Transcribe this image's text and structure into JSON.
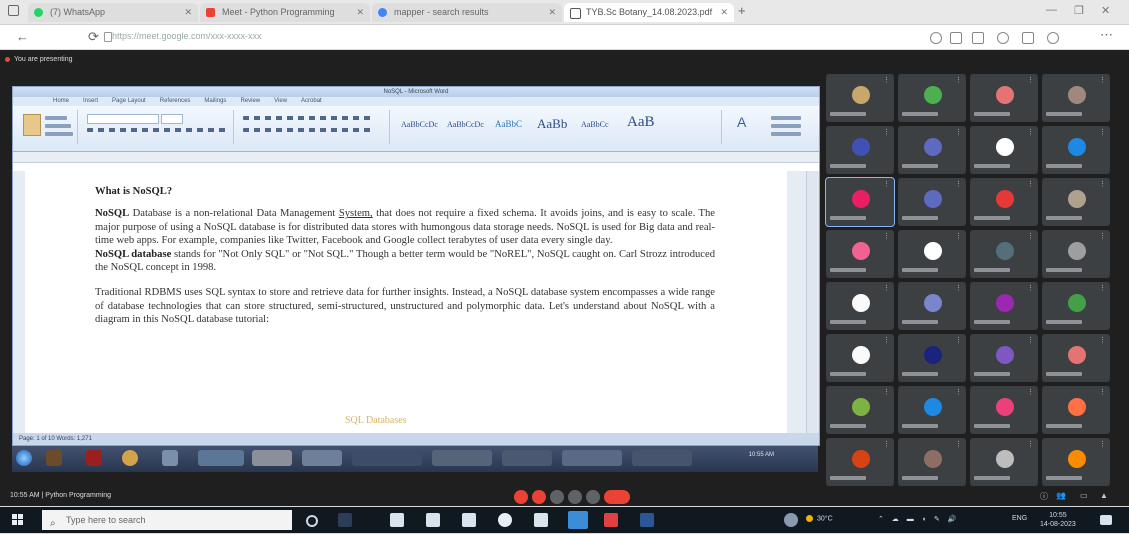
{
  "browser": {
    "tabs": [
      {
        "label": "(7) WhatsApp",
        "active": false,
        "icon_color": "#25d366"
      },
      {
        "label": "Meet - Python Programming",
        "active": false,
        "icon_color": "#ea4335"
      },
      {
        "label": "mapper - search results",
        "active": false,
        "icon_color": "#4285f4"
      },
      {
        "label": "TYB.Sc Botany_14.08.2023.pdf",
        "active": true,
        "icon_color": "#555555"
      }
    ],
    "new_tab": "+",
    "url": "https://meet.google.com/xxx-xxxx-xxx"
  },
  "meet": {
    "presenting_label": "You are presenting",
    "meeting_name": "10:55 AM | Python Programming",
    "participant_tile_colors": [
      "#c9a66b",
      "#4caf50",
      "#e57373",
      "#a1887f",
      "#3f51b5",
      "#5c6bc0",
      "#ffffff",
      "#1e88e5",
      "#e91e63",
      "#5c6bc0",
      "#e53935",
      "#b0a090",
      "#f06292",
      "#ffffff",
      "#546e7a",
      "#9e9e9e",
      "#fafafa",
      "#7986cb",
      "#9c27b0",
      "#43a047",
      "#fafafa",
      "#1a237e",
      "#7e57c2",
      "#e57373",
      "#7cb342",
      "#1e88e5",
      "#ec407a",
      "#ff7043",
      "#d84315",
      "#8d6e63",
      "#bdbdbd",
      "#fb8c00"
    ]
  },
  "word": {
    "title": "NoSQL - Microsoft Word",
    "ribbon_tabs": [
      "Home",
      "Insert",
      "Page Layout",
      "References",
      "Mailings",
      "Review",
      "View",
      "Acrobat"
    ],
    "style_samples": [
      "AaBbCcDc",
      "AaBbCcDc",
      "AaBbC",
      "AaBb",
      "AaBbCc",
      "AaB"
    ],
    "status": "Page: 1 of 10   Words: 1,271",
    "heading": "What is NoSQL?",
    "p1_bold": "NoSQL",
    "p1_a": " Database is a non-relational Data Management ",
    "p1_u": "System,",
    "p1_b": " that does not require a fixed schema. It avoids joins, and is easy to scale. The major purpose of using a NoSQL database is for distributed data stores with humongous data storage needs. NoSQL is used for Big data and real-time web apps. For example, companies like Twitter, Facebook and Google collect terabytes of user data every single day.",
    "p2_bold": "NoSQL database",
    "p2_rest": " stands for \"Not Only SQL\" or \"Not SQL.\" Though a better term would be \"NoREL\", NoSQL caught on. Carl Strozz introduced the NoSQL concept in 1998.",
    "p3": "Traditional RDBMS uses SQL syntax to store and retrieve data for further insights. Instead, a NoSQL database system encompasses a wide range of database technologies that can store structured, semi-structured, unstructured and polymorphic data. Let's understand about NoSQL with a diagram in this NoSQL database tutorial:",
    "figure_caption": "SQL Databases",
    "inner_clock": "10:55 AM"
  },
  "taskbar": {
    "search_placeholder": "Type here to search",
    "weather": "30°C",
    "language": "ENG",
    "time": "10:55",
    "date": "14-08-2023"
  }
}
